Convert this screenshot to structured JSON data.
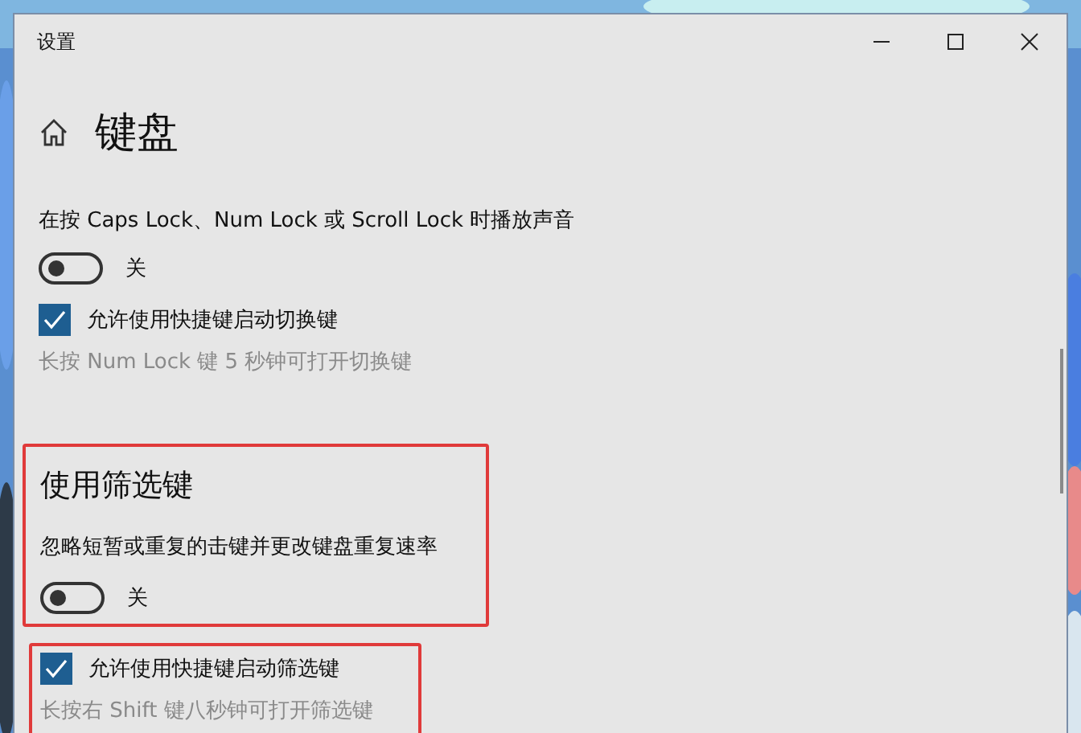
{
  "window": {
    "title": "设置"
  },
  "page": {
    "title": "键盘"
  },
  "groups": [
    {
      "highlighted": false,
      "items": [
        {
          "kind": "text",
          "text": "在按 Caps Lock、Num Lock 或 Scroll Lock 时播放声音"
        },
        {
          "kind": "toggle",
          "on": false,
          "label": "关"
        },
        {
          "kind": "checkbox",
          "checked": true,
          "label": "允许使用快捷键启动切换键"
        },
        {
          "kind": "hint",
          "text": "长按 Num Lock 键 5 秒钟可打开切换键"
        }
      ]
    },
    {
      "highlighted": true,
      "items": [
        {
          "kind": "heading",
          "text": "使用筛选键"
        },
        {
          "kind": "text",
          "text": "忽略短暂或重复的击键并更改键盘重复速率"
        },
        {
          "kind": "toggle",
          "on": false,
          "label": "关"
        }
      ]
    },
    {
      "highlighted": true,
      "items": [
        {
          "kind": "checkbox",
          "checked": true,
          "label": "允许使用快捷键启动筛选键"
        },
        {
          "kind": "hint",
          "text": "长按右 Shift 键八秒钟可打开筛选键"
        }
      ]
    }
  ]
}
